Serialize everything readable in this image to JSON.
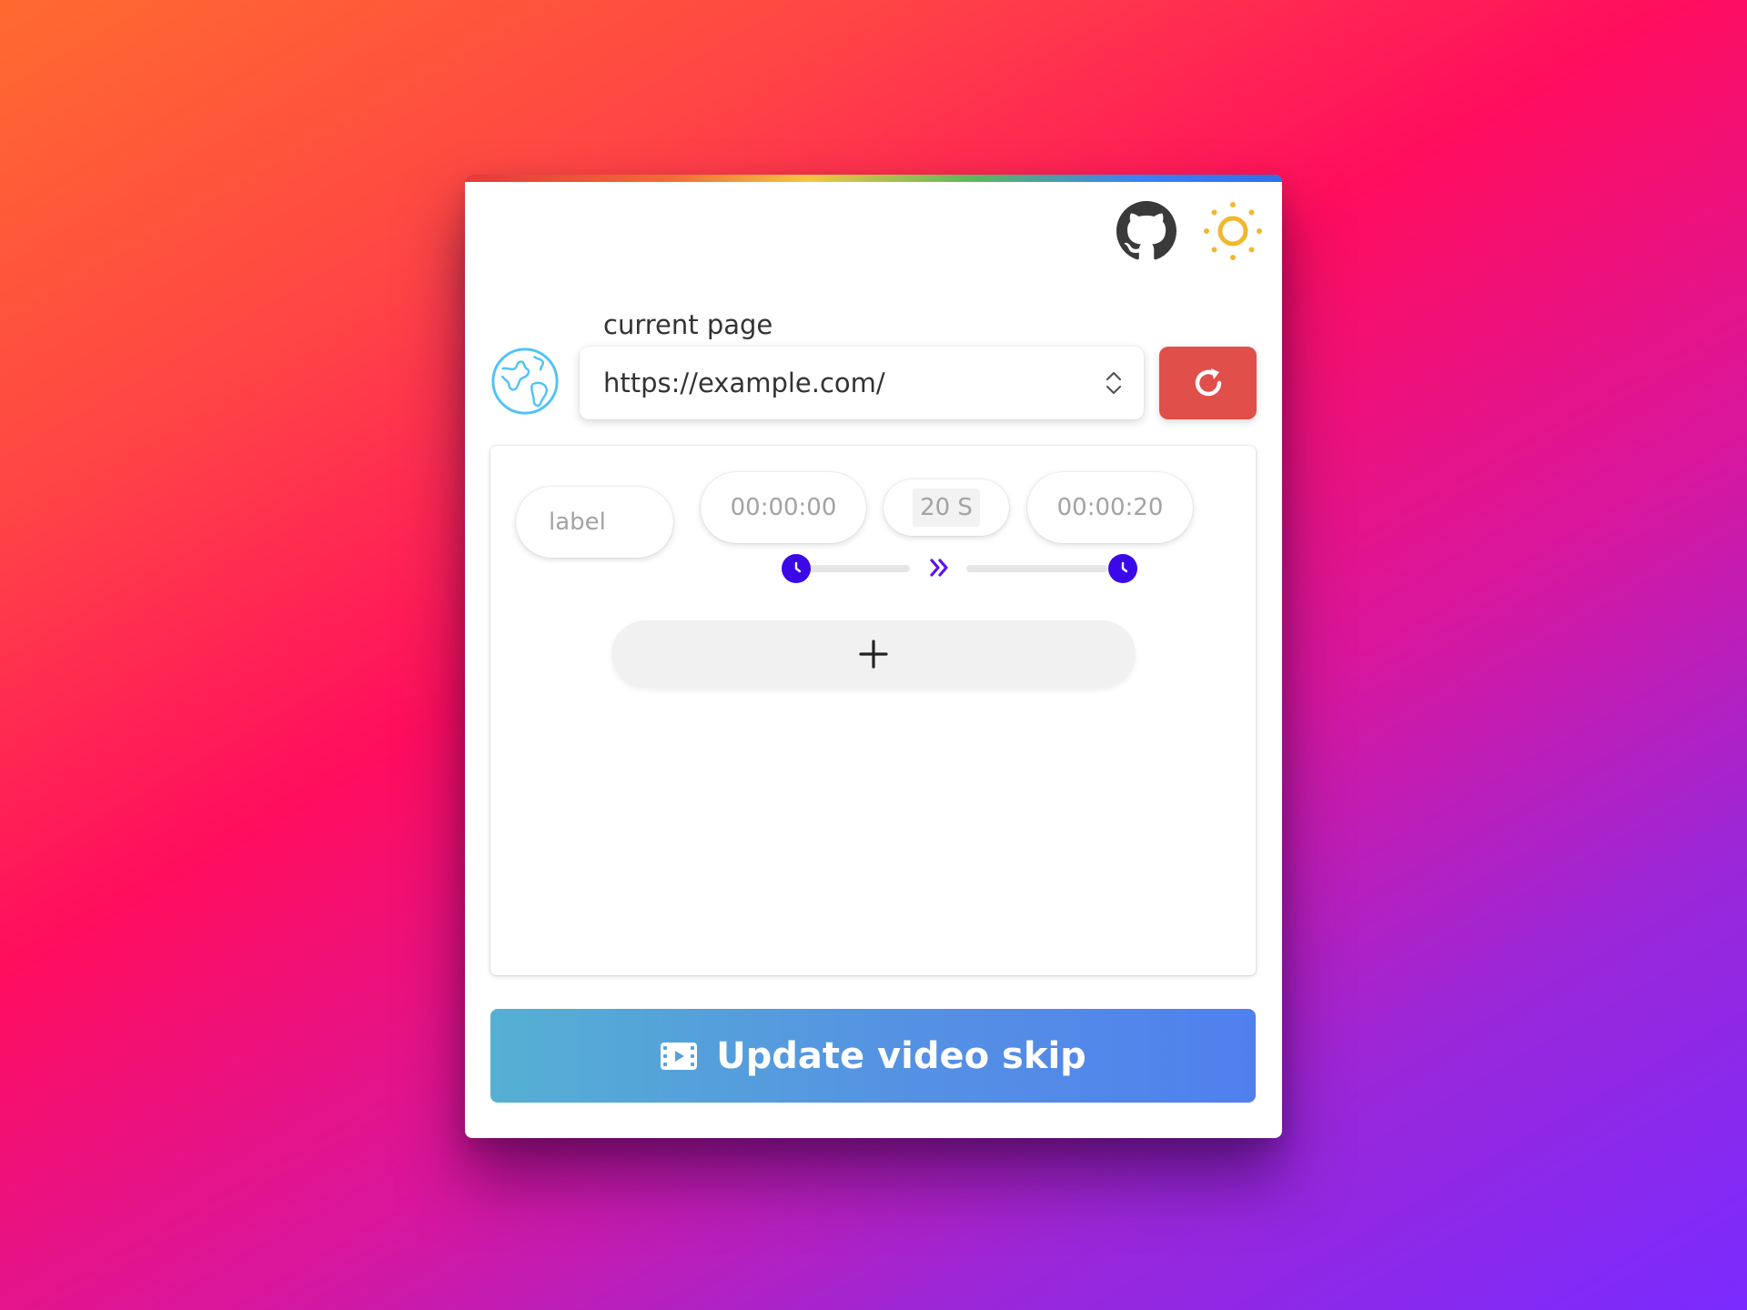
{
  "header": {
    "github_icon": "github-icon",
    "theme_icon": "sun-icon"
  },
  "page": {
    "label": "current page",
    "url": "https://example.com/",
    "globe_icon": "globe-icon",
    "refresh_icon": "refresh-icon"
  },
  "segment": {
    "label_placeholder": "label",
    "start_time": "00:00:00",
    "duration": "20 S",
    "end_time": "00:00:20",
    "skip_icon": "double-chevron-right-icon",
    "knob_icon": "clock-icon"
  },
  "add_button": {
    "label": "+"
  },
  "update_button": {
    "label": "Update video skip",
    "icon": "film-icon"
  },
  "colors": {
    "accent_red": "#e04f4a",
    "knob_blue": "#3b09e8",
    "sun_yellow": "#f0b82e",
    "globe_blue": "#4fc3f7",
    "update_gradient_start": "#55b0d3",
    "update_gradient_end": "#5080ee"
  }
}
